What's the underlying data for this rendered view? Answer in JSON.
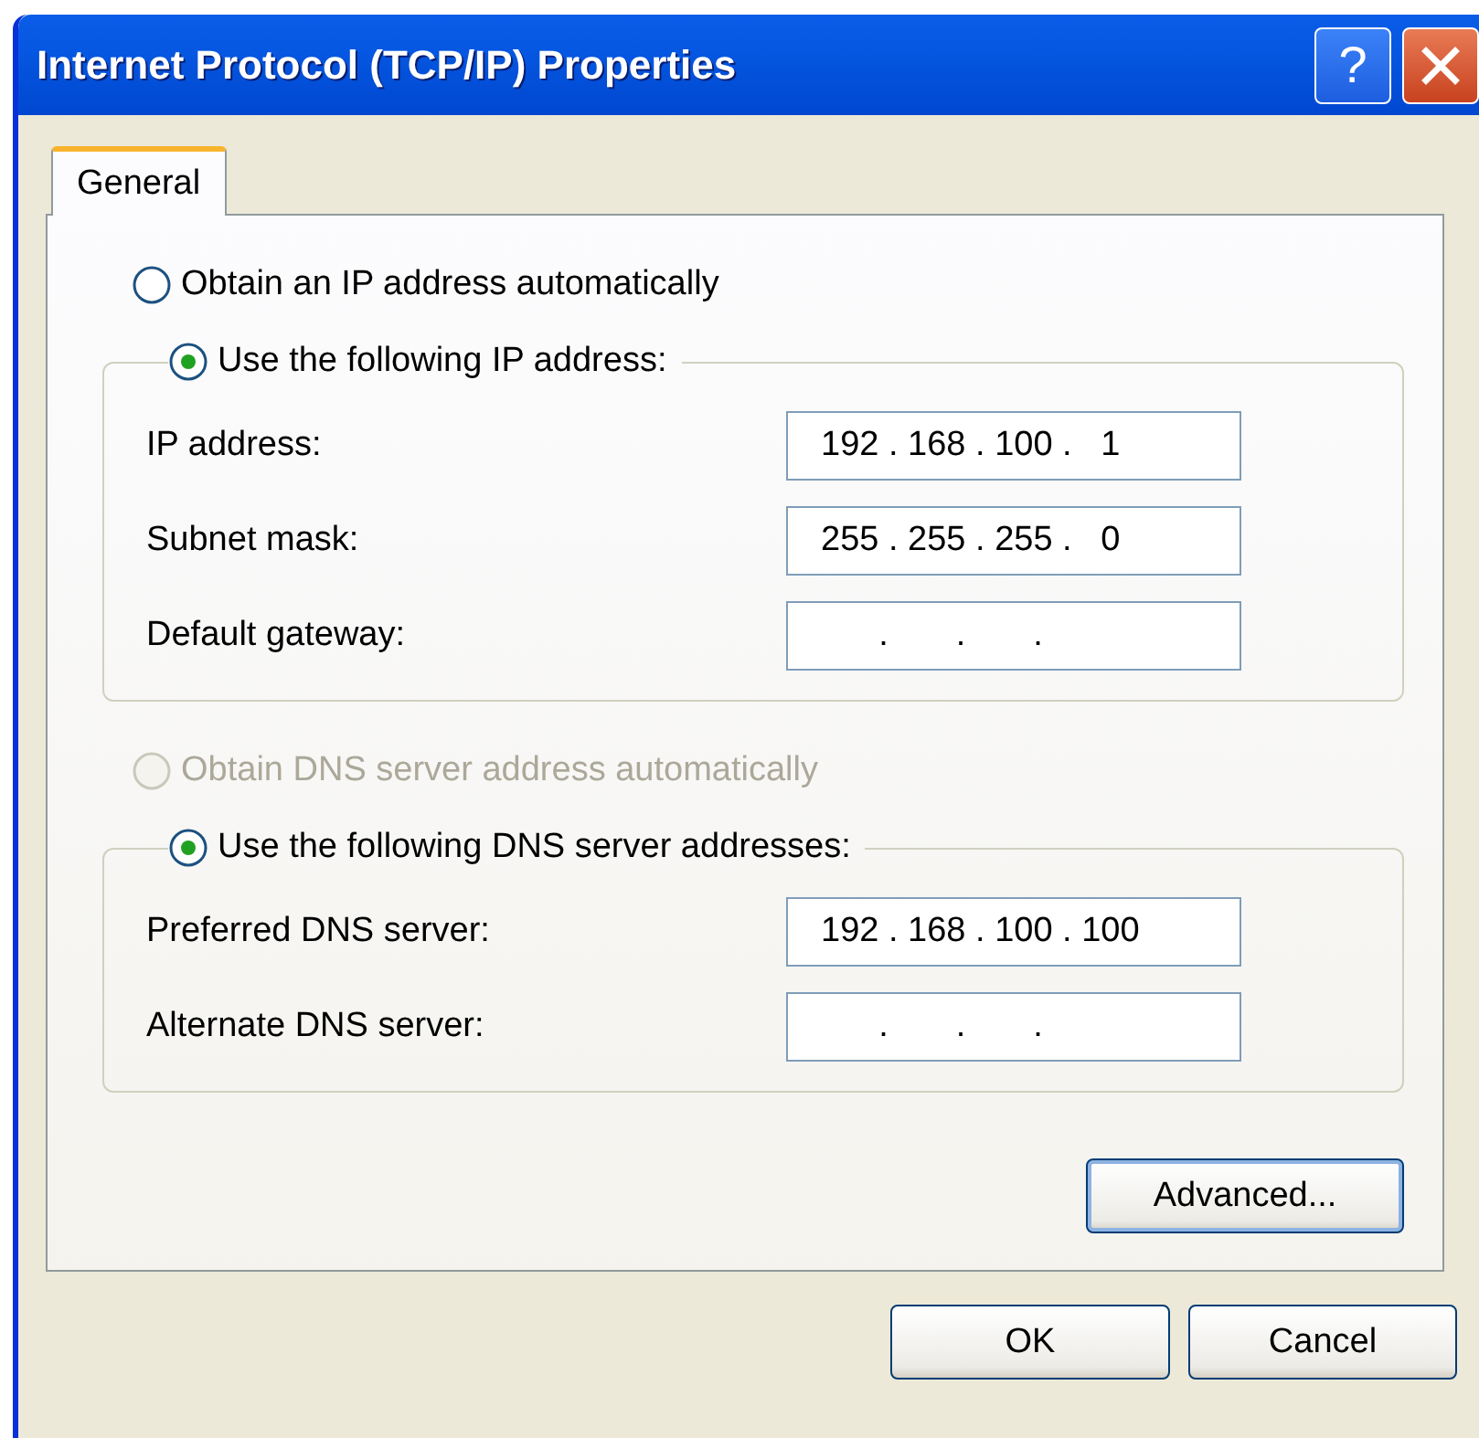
{
  "window": {
    "title": "Internet Protocol (TCP/IP) Properties",
    "help_label": "?"
  },
  "tabs": [
    {
      "label": "General",
      "selected": true
    }
  ],
  "ip_options": [
    {
      "label": "Obtain an IP address automatically",
      "selected": false,
      "disabled": false
    },
    {
      "label": "Use the following IP address:",
      "selected": true,
      "disabled": false
    }
  ],
  "ip_fields": [
    {
      "label": "IP address:",
      "value": "192 . 168 . 100 .   1"
    },
    {
      "label": "Subnet mask:",
      "value": "255 . 255 . 255 .   0"
    },
    {
      "label": "Default gateway:",
      "value": "      .       .       ."
    }
  ],
  "dns_options": [
    {
      "label": "Obtain DNS server address automatically",
      "selected": false,
      "disabled": true
    },
    {
      "label": "Use the following DNS server addresses:",
      "selected": true,
      "disabled": false
    }
  ],
  "dns_fields": [
    {
      "label": "Preferred DNS server:",
      "value": "192 . 168 . 100 . 100"
    },
    {
      "label": "Alternate DNS server:",
      "value": "      .       .       ."
    }
  ],
  "advanced_button": "Advanced...",
  "buttons": [
    "OK",
    "Cancel"
  ]
}
